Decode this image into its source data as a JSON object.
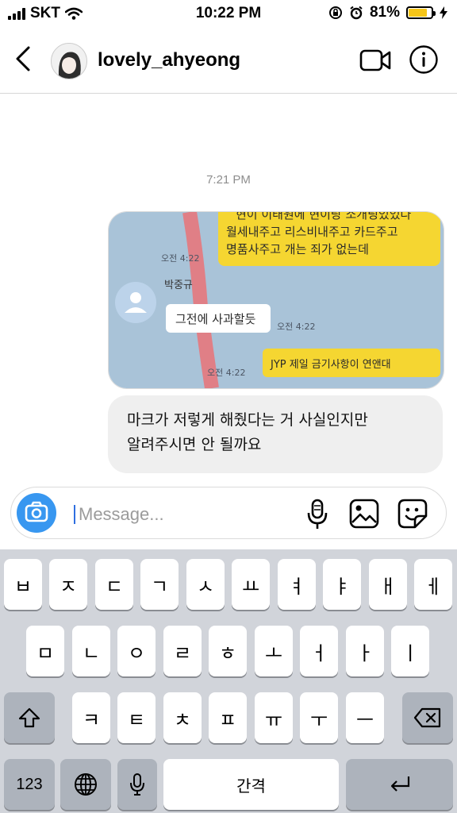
{
  "status_bar": {
    "carrier": "SKT",
    "time": "10:22 PM",
    "battery_percent": "81%",
    "battery_level": 0.81,
    "icons": [
      "signal-icon",
      "wifi-icon",
      "orientation-lock-icon",
      "alarm-icon",
      "battery-icon",
      "charging-icon"
    ]
  },
  "header": {
    "username": "lovely_ahyeong",
    "icons": [
      "back-icon",
      "avatar",
      "video-call-icon",
      "info-icon"
    ]
  },
  "thread": {
    "timestamp": "7:21 PM",
    "photo": {
      "yellow_lines": [
        "현이 이태원에 현이랑 소개팅있었다",
        "월세내주고 리스비내주고 카드주고",
        "명품사주고 개는 죄가 없는데"
      ],
      "time_1": "오전 4:22",
      "sender": "박중규",
      "white_bubble": "그전에 사과할듯",
      "time_2": "오전 4:22",
      "yellow_bubble_2": "JYP 제일 금기사항이 연앤대",
      "time_3": "오전 4:22"
    },
    "message_lines": [
      "마크가 저렇게 해줬다는 거 사실인지만",
      "알려주시면 안 될까요"
    ]
  },
  "composer": {
    "placeholder": "Message...",
    "icons": [
      "camera-icon",
      "microphone-icon",
      "gallery-icon",
      "sticker-icon"
    ]
  },
  "keyboard": {
    "row1": [
      "ㅂ",
      "ㅈ",
      "ㄷ",
      "ㄱ",
      "ㅅ",
      "ㅛ",
      "ㅕ",
      "ㅑ",
      "ㅐ",
      "ㅔ"
    ],
    "row2": [
      "ㅁ",
      "ㄴ",
      "ㅇ",
      "ㄹ",
      "ㅎ",
      "ㅗ",
      "ㅓ",
      "ㅏ",
      "ㅣ"
    ],
    "row3": [
      "ㅋ",
      "ㅌ",
      "ㅊ",
      "ㅍ",
      "ㅠ",
      "ㅜ",
      "ㅡ"
    ],
    "numbers_key": "123",
    "space_key": "간격",
    "icons": [
      "shift-icon",
      "backspace-icon",
      "globe-icon",
      "dictation-icon",
      "return-icon"
    ]
  },
  "colors": {
    "accent_blue": "#3897f0",
    "battery_yellow": "#f5c518",
    "message_bubble": "#efefef",
    "keyboard_bg": "#d1d4da",
    "kakao_yellow": "#f5d631"
  }
}
